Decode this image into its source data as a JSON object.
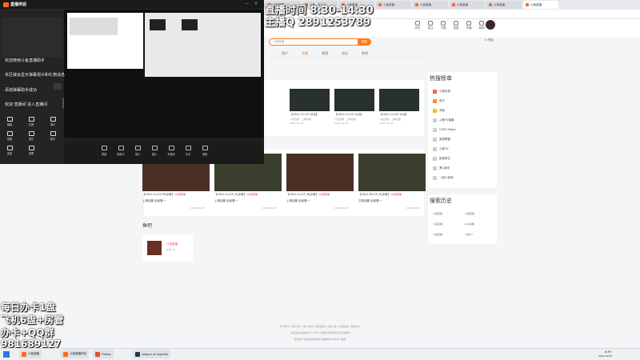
{
  "browser": {
    "tabs": [
      {
        "label": "斗鱼直播"
      },
      {
        "label": "斗鱼 - 每个人"
      },
      {
        "label": "斗鱼直播"
      },
      {
        "label": "斗鱼直播"
      },
      {
        "label": "斗鱼直播"
      },
      {
        "label": "斗鱼直播"
      },
      {
        "label": "斗鱼直播"
      },
      {
        "label": "斗鱼直播"
      }
    ]
  },
  "site": {
    "search_placeholder": "斗鱼直播",
    "search_button": "搜索",
    "header_icons": [
      {
        "label": "历史",
        "icon": "history-icon"
      },
      {
        "label": "关注",
        "icon": "follow-icon"
      },
      {
        "label": "下载",
        "icon": "download-icon"
      },
      {
        "label": "消息",
        "icon": "message-icon"
      },
      {
        "label": "开播",
        "icon": "broadcast-icon"
      },
      {
        "label": "鱼吧",
        "icon": "fishbar-icon"
      }
    ],
    "tabs": [
      "用户",
      "直播",
      "视频",
      "论坛",
      "鱼吧"
    ],
    "selected_tab": "直播",
    "videos_row1": [
      {
        "title": "【2021-11-03 10点】",
        "sub": "斗鱼直播 · 上单剑魔",
        "date": "2021-11-03"
      },
      {
        "title": "【2021-11-03 10点】",
        "sub": "斗鱼直播 · 上单剑魔",
        "date": "2021-11-03"
      },
      {
        "title": "【2021-11-02 10点】",
        "sub": "斗鱼直播 · 上单剑魔",
        "date": "2021-11-02"
      }
    ],
    "videos_row2": [
      {
        "tag": "【2021-11-02 09点场】",
        "hot": "斗鱼直播",
        "title": "上单剑魔 全民第一",
        "date": "2021-11-02"
      },
      {
        "tag": "【2021-11-02 10点场】",
        "hot": "斗鱼直播",
        "title": "上单剑魔 全民第一",
        "date": "2021-11-02"
      },
      {
        "tag": "【2021-11-02 18点场】",
        "hot": "斗鱼直播",
        "title": "上单剑魔 全民第一",
        "date": "2021-11-02"
      },
      {
        "tag": "【2021-09-29 10点场】",
        "hot": "斗鱼直播",
        "title": "万场剑魔 全民第一",
        "date": "2021-09-29"
      }
    ],
    "fishbar_heading": "鱼吧",
    "fishbar_card": {
      "name": "斗鱼直播",
      "meta": "关注 12"
    },
    "rank_heading": "热搜榜单",
    "rank": [
      {
        "n": "1",
        "label": "斗鱼年度"
      },
      {
        "n": "2",
        "label": "电子"
      },
      {
        "n": "3",
        "label": "寻鱼"
      },
      {
        "n": "4",
        "label": "斗鱼TV直播"
      },
      {
        "n": "5",
        "label": "CSGO Major"
      },
      {
        "n": "6",
        "label": "英雄联盟"
      },
      {
        "n": "7",
        "label": "斗鱼TV"
      },
      {
        "n": "8",
        "label": "绝地求生"
      },
      {
        "n": "9",
        "label": "第1游戏"
      },
      {
        "n": "10",
        "label": "一起小游戏"
      }
    ],
    "history_heading": "搜索历史",
    "history": [
      {
        "left": "斗鱼直播",
        "right": "斗鱼直播"
      },
      {
        "left": "斗鱼直播",
        "right": "LOL剑魔"
      },
      {
        "left": "斗鱼直播",
        "right": "斗鱼TV"
      }
    ],
    "footer_lines": [
      "关于我们 | 商务合作 | 用户协议 | 隐私政策 | 主播入驻 | 友情链接 | 帮助中心",
      "斗鱼直播 版权所有 © 2021 网络文化经营许可证 鄂网文",
      "违法和不良信息举报电话 举报邮箱 未成年人保护"
    ]
  },
  "overlay": {
    "time_line": "直播时间 8:30-14:30",
    "qq_line": "主播Q 2891253789",
    "promo": [
      "每日办卡1盘",
      "飞机6盘+房管",
      "办卡+QQ群",
      "981689127"
    ],
    "app_title": "直播伴侣",
    "app_lines": [
      "欢迎使用斗鱼直播助手",
      "本区域会显示弹幕观众和礼物消息",
      "添加弹幕助手成功",
      "欢迎 直播间 进入直播间"
    ],
    "side_buttons": [
      "弹幕",
      "礼物",
      "观众",
      "设置",
      "音乐",
      "助手",
      "连麦",
      "投屏"
    ],
    "tools": [
      "屏幕",
      "摄像头",
      "窗口",
      "图片",
      "多媒体",
      "文本",
      "音频"
    ]
  },
  "taskbar": {
    "items": [
      {
        "label": "斗鱼直播",
        "color": "#ff6a1a"
      },
      {
        "label": "斗鱼直播伴侣",
        "color": "#ff6a1a"
      },
      {
        "label": "Firefox",
        "color": "#e64c2e"
      },
      {
        "label": "League of Legends",
        "color": "#1c3a4a"
      }
    ],
    "clock_time": "8:39",
    "clock_date": "2021/11/03"
  }
}
